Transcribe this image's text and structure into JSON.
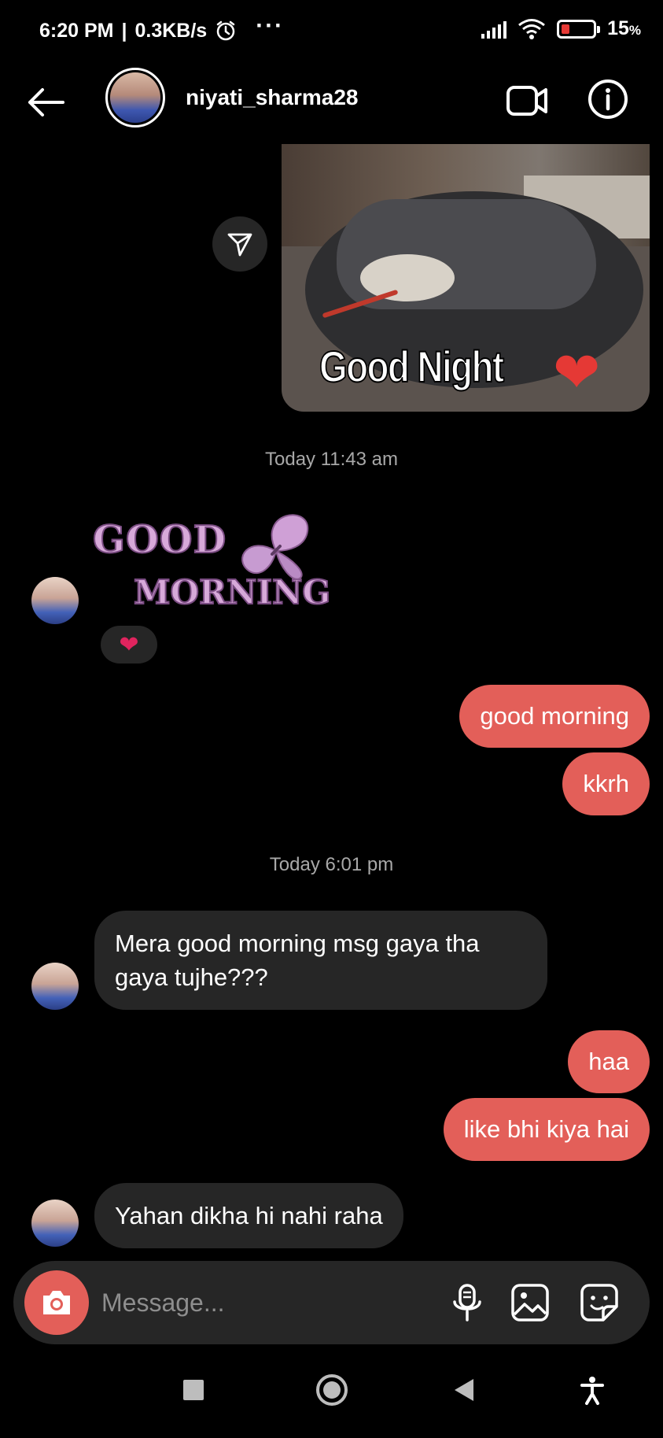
{
  "status_bar": {
    "time": "6:20 PM",
    "separator": "|",
    "speed": "0.3KB/s",
    "more": "···",
    "battery_percent": "15",
    "battery_unit": "%",
    "battery_level": 0.15
  },
  "header": {
    "username": "niyati_sharma28"
  },
  "messages": {
    "sent_image": {
      "caption": "Good Night",
      "heart": "❤"
    },
    "timestamp_1": "Today 11:43 am",
    "sticker": {
      "line1": "GOOD",
      "line2": "MORNING"
    },
    "reaction": "❤",
    "out_1": "good morning",
    "out_2": "kkrh",
    "timestamp_2": "Today 6:01 pm",
    "in_1": "Mera good morning msg gaya tha gaya tujhe???",
    "out_3": "haa",
    "out_4": "like bhi kiya hai",
    "in_2": "Yahan dikha hi nahi raha"
  },
  "composer": {
    "placeholder": "Message..."
  },
  "colors": {
    "accent": "#e35f59",
    "incoming_bubble": "#262626",
    "background": "#000000",
    "timestamp": "#a8a8a8"
  },
  "icons": {
    "back": "arrow-left-icon",
    "video": "video-camera-icon",
    "info": "info-icon",
    "share": "send-icon",
    "camera": "camera-icon",
    "mic": "microphone-icon",
    "gallery": "image-icon",
    "sticker": "sticker-icon"
  }
}
